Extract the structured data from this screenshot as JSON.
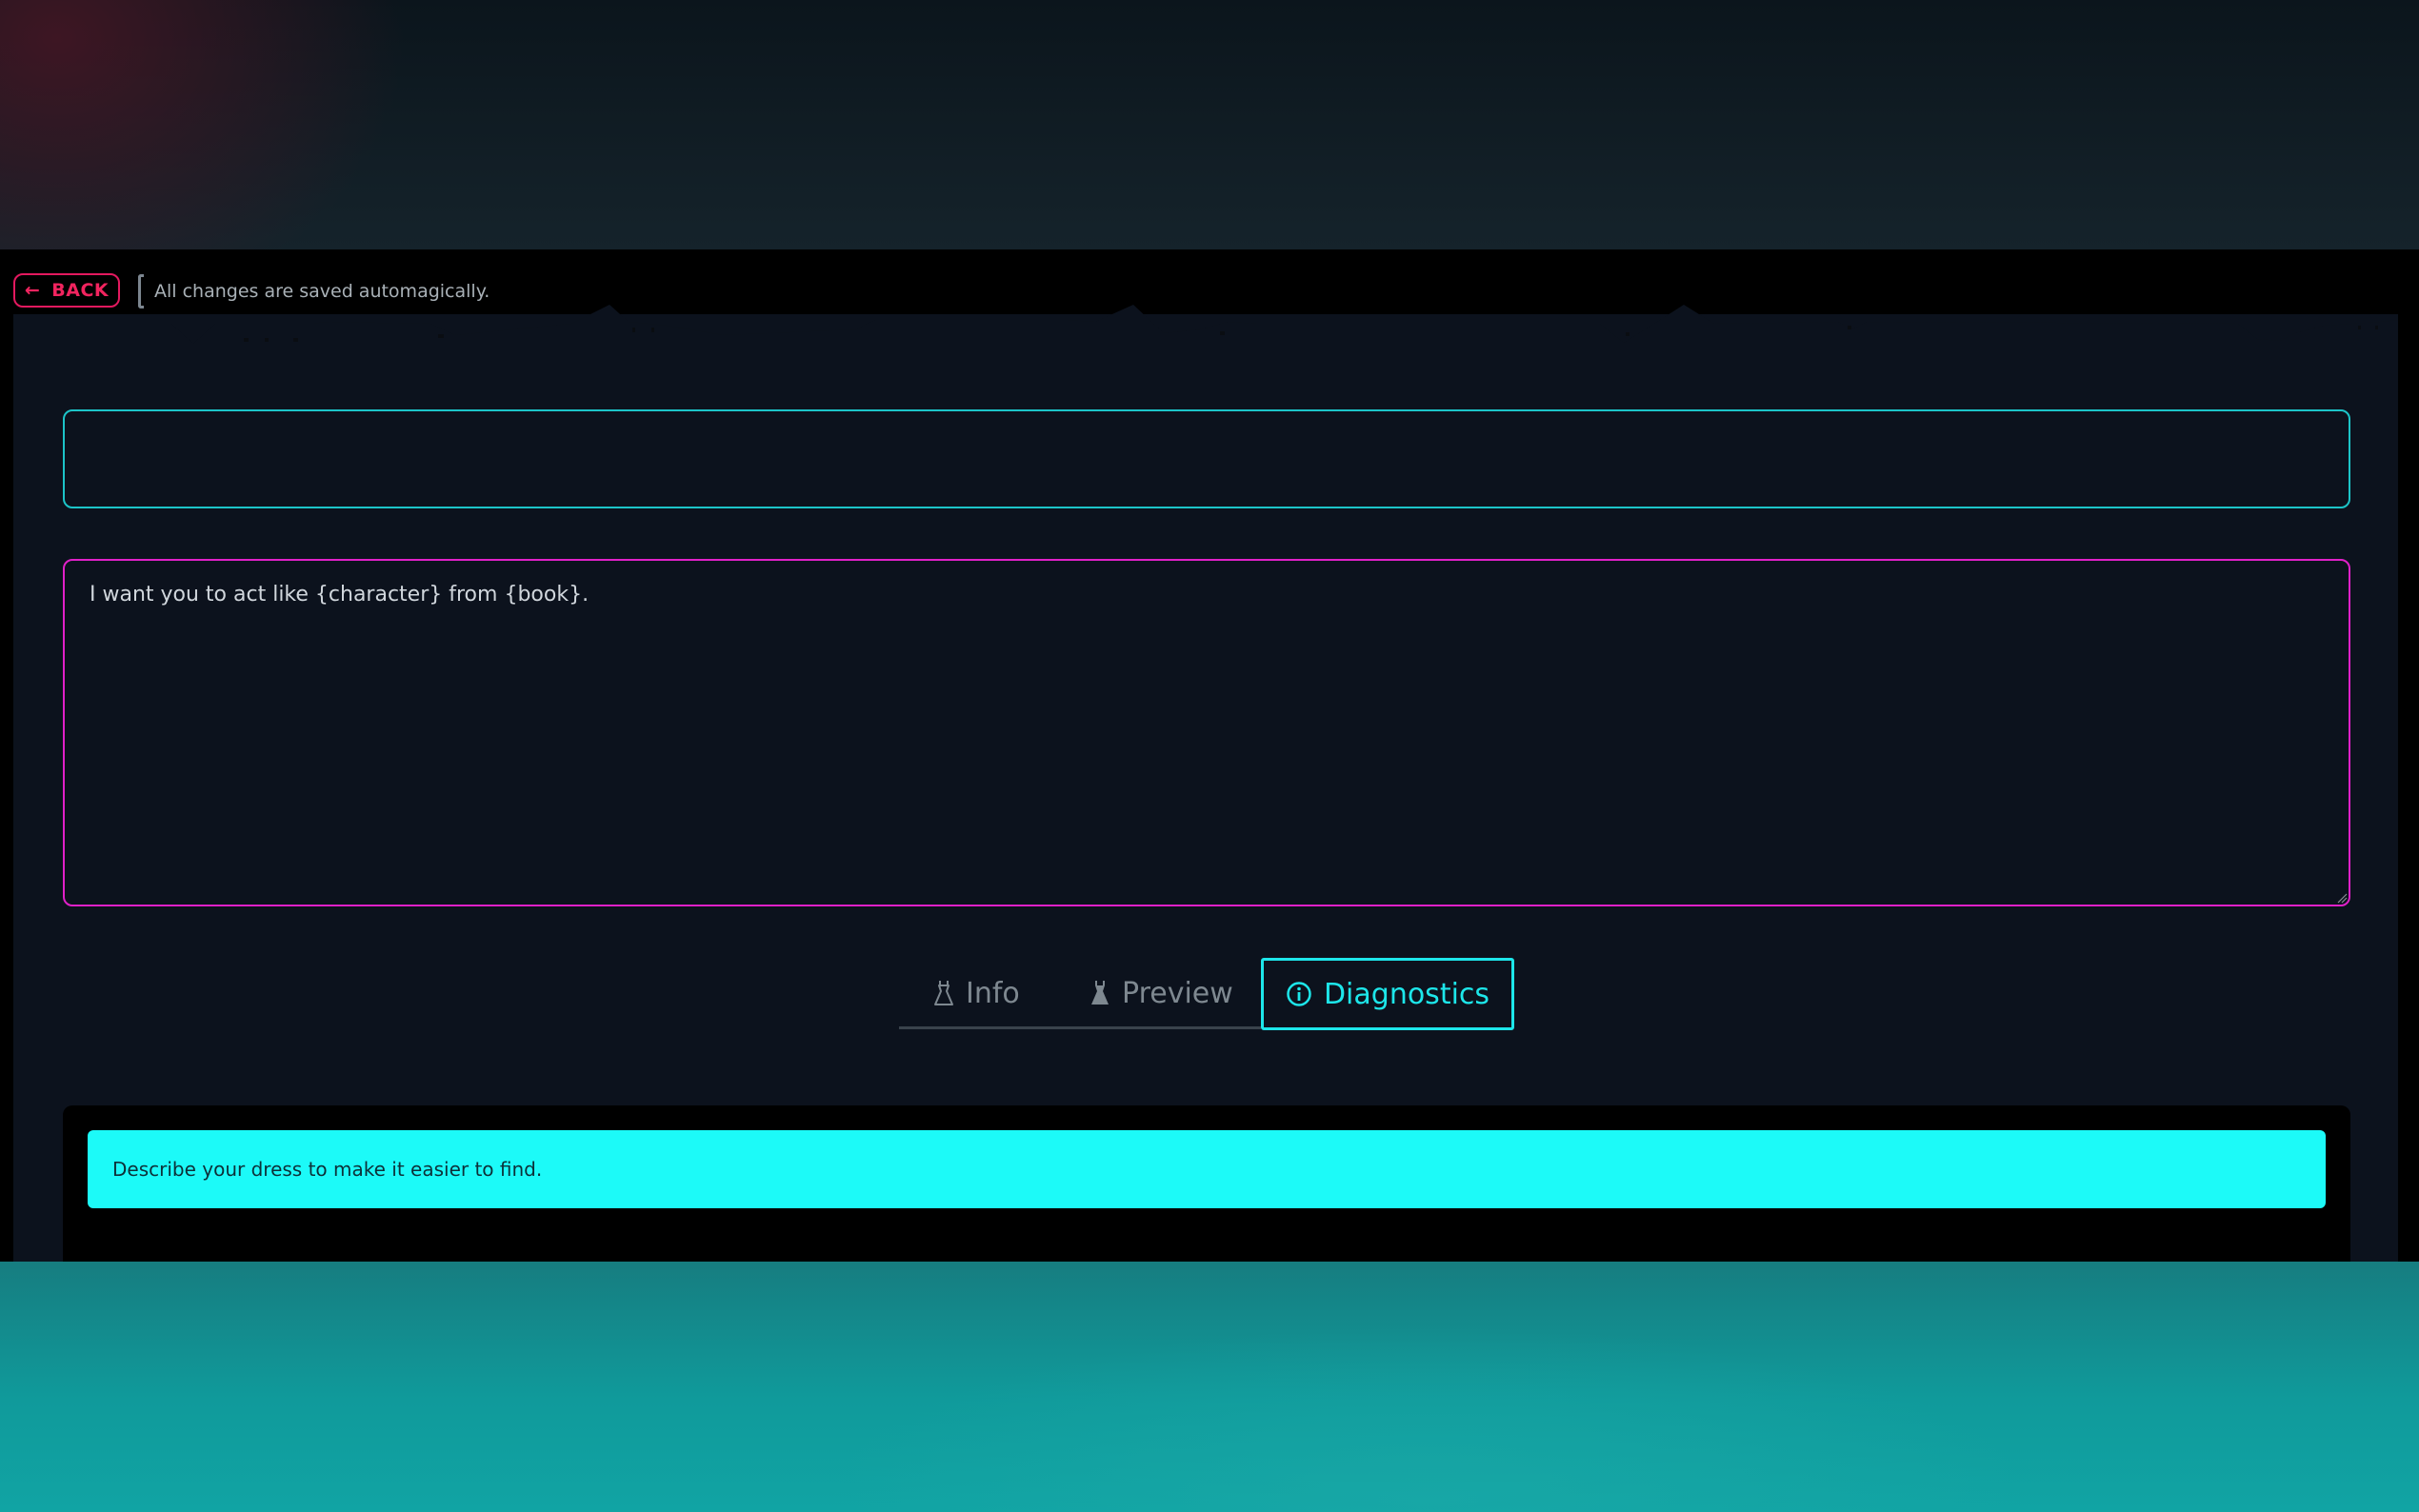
{
  "header": {
    "back_label": "BACK",
    "save_status": "All changes are saved automagically."
  },
  "editor": {
    "title_value": "",
    "prompt_value": "I want you to act like {character} from {book}."
  },
  "tabs": [
    {
      "label": "Info",
      "icon": "dress-outline-icon",
      "active": false
    },
    {
      "label": "Preview",
      "icon": "dress-filled-icon",
      "active": false
    },
    {
      "label": "Diagnostics",
      "icon": "info-circle-icon",
      "active": true
    }
  ],
  "diagnostics": {
    "message": "Describe your dress to make it easier to find."
  },
  "colors": {
    "back_accent": "#e3195f",
    "title_border": "#1cc4c8",
    "prompt_border": "#e020c8",
    "active_tab": "#1de6ea",
    "hint_background": "#1cfaf8"
  }
}
